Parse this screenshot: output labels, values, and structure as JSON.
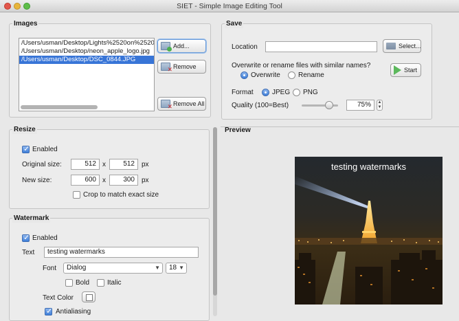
{
  "window": {
    "title": "SIET - Simple Image Editing Tool"
  },
  "images": {
    "title": "Images",
    "files": [
      "/Users/usman/Desktop/Lights%2520on%2520",
      "/Users/usman/Desktop/neon_apple_logo.jpg",
      "/Users/usman/Desktop/DSC_0844.JPG"
    ],
    "selected_index": 2,
    "add_label": "Add...",
    "remove_label": "Remove",
    "remove_all_label": "Remove All"
  },
  "save": {
    "title": "Save",
    "location_label": "Location",
    "location_value": "",
    "select_label": "Select...",
    "overwrite_question": "Overwrite or rename files with similar names?",
    "overwrite_label": "Overwrite",
    "rename_label": "Rename",
    "start_label": "Start",
    "format_label": "Format",
    "jpeg_label": "JPEG",
    "png_label": "PNG",
    "quality_label": "Quality (100=Best)",
    "quality_value": "75%",
    "quality_fraction": 0.75
  },
  "resize": {
    "title": "Resize",
    "enabled_label": "Enabled",
    "original_label": "Original size:",
    "original_w": "512",
    "original_h": "512",
    "new_label": "New size:",
    "new_w": "600",
    "new_h": "300",
    "x_sep": "x",
    "unit": "px",
    "crop_label": "Crop to match exact size"
  },
  "watermark": {
    "title": "Watermark",
    "enabled_label": "Enabled",
    "text_label": "Text",
    "text_value": "testing watermarks",
    "font_label": "Font",
    "font_value": "Dialog",
    "size_value": "18",
    "bold_label": "Bold",
    "italic_label": "Italic",
    "color_label": "Text Color",
    "antialias_label": "Antialiasing"
  },
  "preview": {
    "title": "Preview",
    "watermark_text": "testing watermarks"
  }
}
